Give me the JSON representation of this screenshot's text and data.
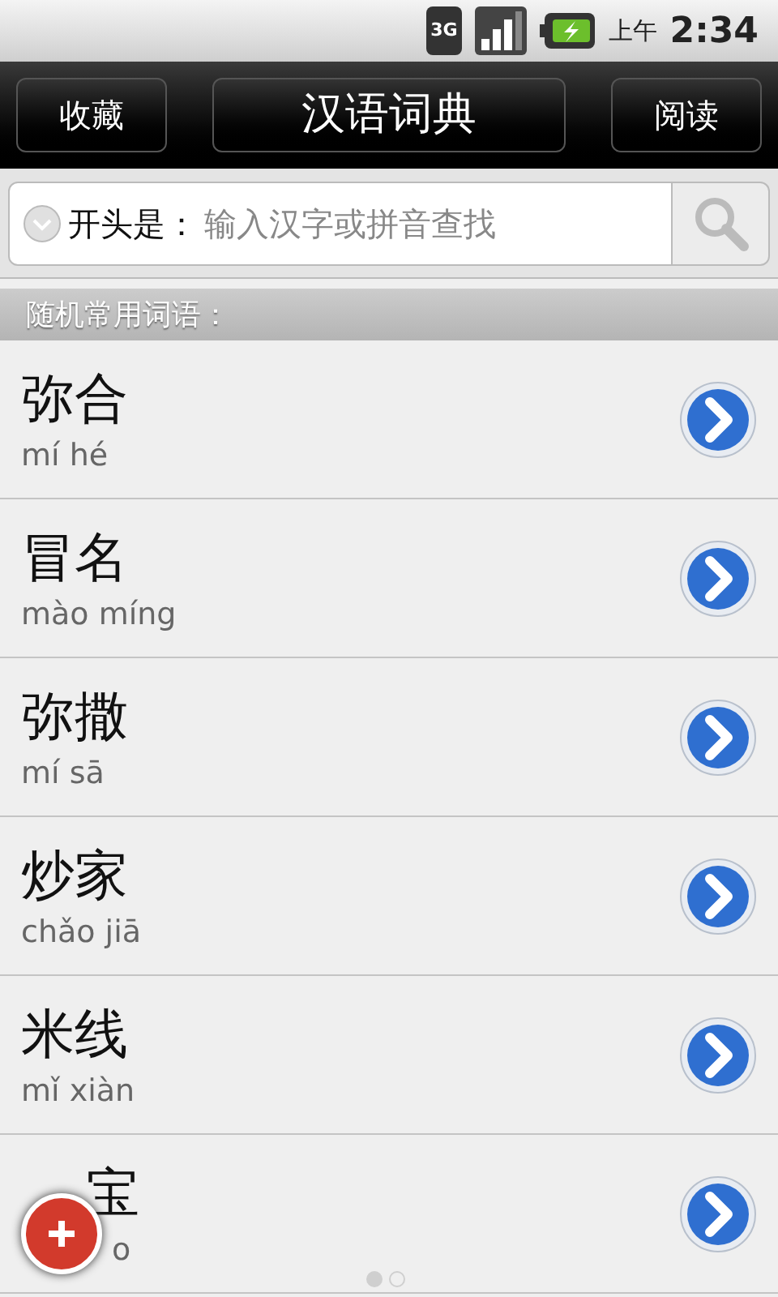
{
  "status_bar": {
    "network": "3G",
    "period": "上午",
    "time": "2:34"
  },
  "title_bar": {
    "left_button": "收藏",
    "title": "汉语词典",
    "right_button": "阅读"
  },
  "search": {
    "prefix": "开头是：",
    "placeholder": "输入汉字或拼音查找"
  },
  "section_header": "随机常用词语：",
  "words": [
    {
      "word": "弥合",
      "pinyin": "mí hé",
      "covered": false
    },
    {
      "word": "冒名",
      "pinyin": "mào míng",
      "covered": false
    },
    {
      "word": "弥撒",
      "pinyin": "mí sā",
      "covered": false
    },
    {
      "word": "炒家",
      "pinyin": "chǎo jiā",
      "covered": false
    },
    {
      "word": "米线",
      "pinyin": "mǐ xiàn",
      "covered": false
    },
    {
      "word": "宝",
      "pinyin": "o",
      "covered": true
    }
  ],
  "pages": [
    {
      "selected": true
    },
    {
      "selected": false
    }
  ]
}
